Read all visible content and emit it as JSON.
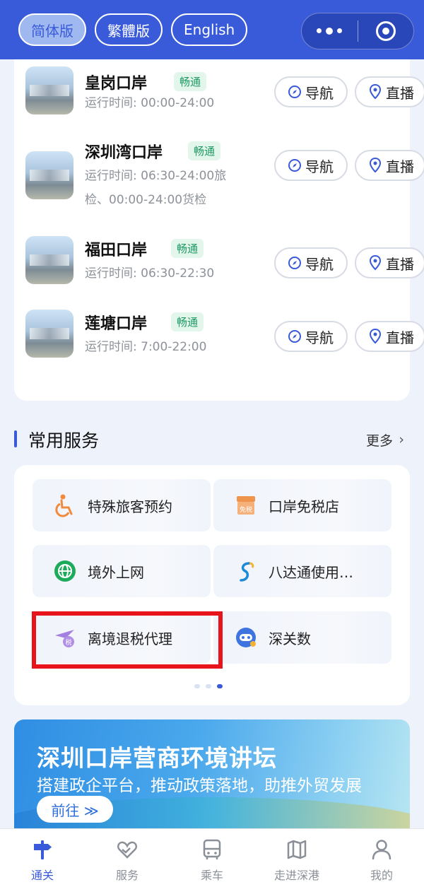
{
  "lang": {
    "simplified": "简体版",
    "traditional": "繁體版",
    "english": "English"
  },
  "ports": [
    {
      "name": "皇岗口岸",
      "status": "畅通",
      "hours": "运行时间: 00:00-24:00",
      "nav": "导航",
      "live": "直播"
    },
    {
      "name": "深圳湾口岸",
      "status": "畅通",
      "hours": "运行时间: 06:30-24:00旅检、00:00-24:00货检",
      "nav": "导航",
      "live": "直播"
    },
    {
      "name": "福田口岸",
      "status": "畅通",
      "hours": "运行时间: 06:30-22:30",
      "nav": "导航",
      "live": "直播"
    },
    {
      "name": "莲塘口岸",
      "status": "畅通",
      "hours": "运行时间: 7:00-22:00",
      "nav": "导航",
      "live": "直播"
    }
  ],
  "services_section": {
    "title": "常用服务",
    "more": "更多"
  },
  "services": [
    {
      "label": "特殊旅客预约",
      "icon": "wheelchair-icon"
    },
    {
      "label": "口岸免税店",
      "icon": "duty-free-shop-icon"
    },
    {
      "label": "境外上网",
      "icon": "globe-icon"
    },
    {
      "label": "八达通使用…",
      "icon": "octopus-card-icon"
    },
    {
      "label": "离境退税代理",
      "icon": "tax-refund-plane-icon"
    },
    {
      "label": "深关数",
      "icon": "robot-icon"
    }
  ],
  "banner": {
    "title": "深圳口岸营商环境讲坛",
    "subtitle": "搭建政企平台，推动政策落地，助推外贸发展",
    "button": "前往 ≫"
  },
  "tabs": [
    {
      "label": "通关",
      "icon": "signpost-icon"
    },
    {
      "label": "服务",
      "icon": "heart-hands-icon"
    },
    {
      "label": "乘车",
      "icon": "bus-icon"
    },
    {
      "label": "走进深港",
      "icon": "map-icon"
    },
    {
      "label": "我的",
      "icon": "user-icon"
    }
  ],
  "colors": {
    "primary": "#3a5bd9",
    "status_green": "#1f9a63",
    "highlight_red": "#e8141c"
  }
}
